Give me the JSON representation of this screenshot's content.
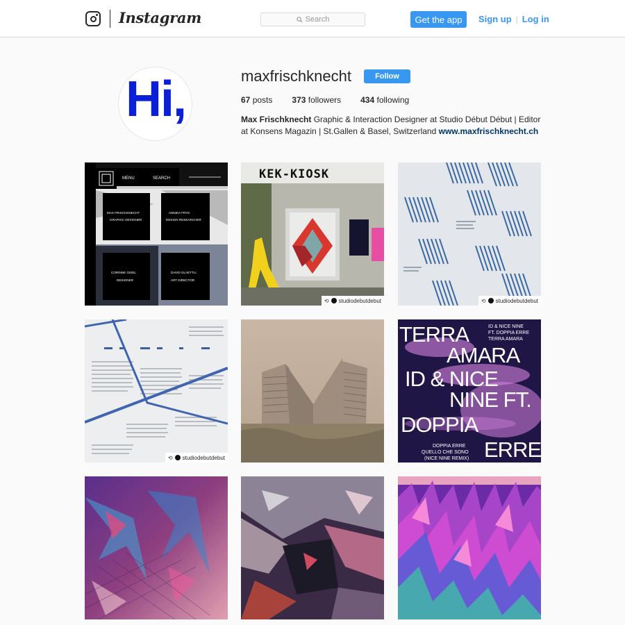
{
  "header": {
    "logo_text": "Instagram",
    "search_placeholder": "Search",
    "get_app_label": "Get the app",
    "signup_label": "Sign up",
    "login_label": "Log in"
  },
  "profile": {
    "avatar_text": "Hi,",
    "username": "maxfrischknecht",
    "follow_label": "Follow",
    "posts_count": "67",
    "posts_label": "posts",
    "followers_count": "373",
    "followers_label": "followers",
    "following_count": "434",
    "following_label": "following",
    "full_name": "Max Frischknecht",
    "bio_text": "Graphic & Interaction Designer at Studio Début Début | Editor at Konsens Magazin | St.Gallen & Basel, Switzerland",
    "website": "www.maxfrischknecht.ch"
  },
  "posts": [
    {
      "id": "post-1",
      "menu_label": "MENU",
      "search_label": "SEARCH",
      "cards": [
        {
          "name": "MAX FRISCHKNECHT",
          "role": "GRAPHIC DESIGNER"
        },
        {
          "name": "ANNIKA FRYE",
          "role": "DESIGN RESEARCHER"
        },
        {
          "name": "CORINNE GISEL",
          "role": "DESIGNER"
        },
        {
          "name": "DAVID GLAETTLI",
          "role": "ART DIRECTOR"
        }
      ]
    },
    {
      "id": "post-2",
      "sign_text": "KEK-KIOSK",
      "repost_label": "studiodebutdebut"
    },
    {
      "id": "post-3",
      "repost_label": "studiodebutdebut"
    },
    {
      "id": "post-4",
      "repost_label": "studiodebutdebut"
    },
    {
      "id": "post-5"
    },
    {
      "id": "post-6",
      "poster_lines": [
        "TERRA",
        "AMARA",
        "ID & NICE",
        "NINE FT.",
        "DOPPIA",
        "ERRE"
      ],
      "small_top": [
        "ID & NICE NINE",
        "FT. DOPPIA ERRE",
        "TERRA AMARA"
      ],
      "small_bottom": [
        "DOPPIA ERRE",
        "QUELLO CHE SONO",
        "(NICE NINE REMIX)"
      ]
    },
    {
      "id": "post-7"
    },
    {
      "id": "post-8"
    },
    {
      "id": "post-9"
    }
  ]
}
